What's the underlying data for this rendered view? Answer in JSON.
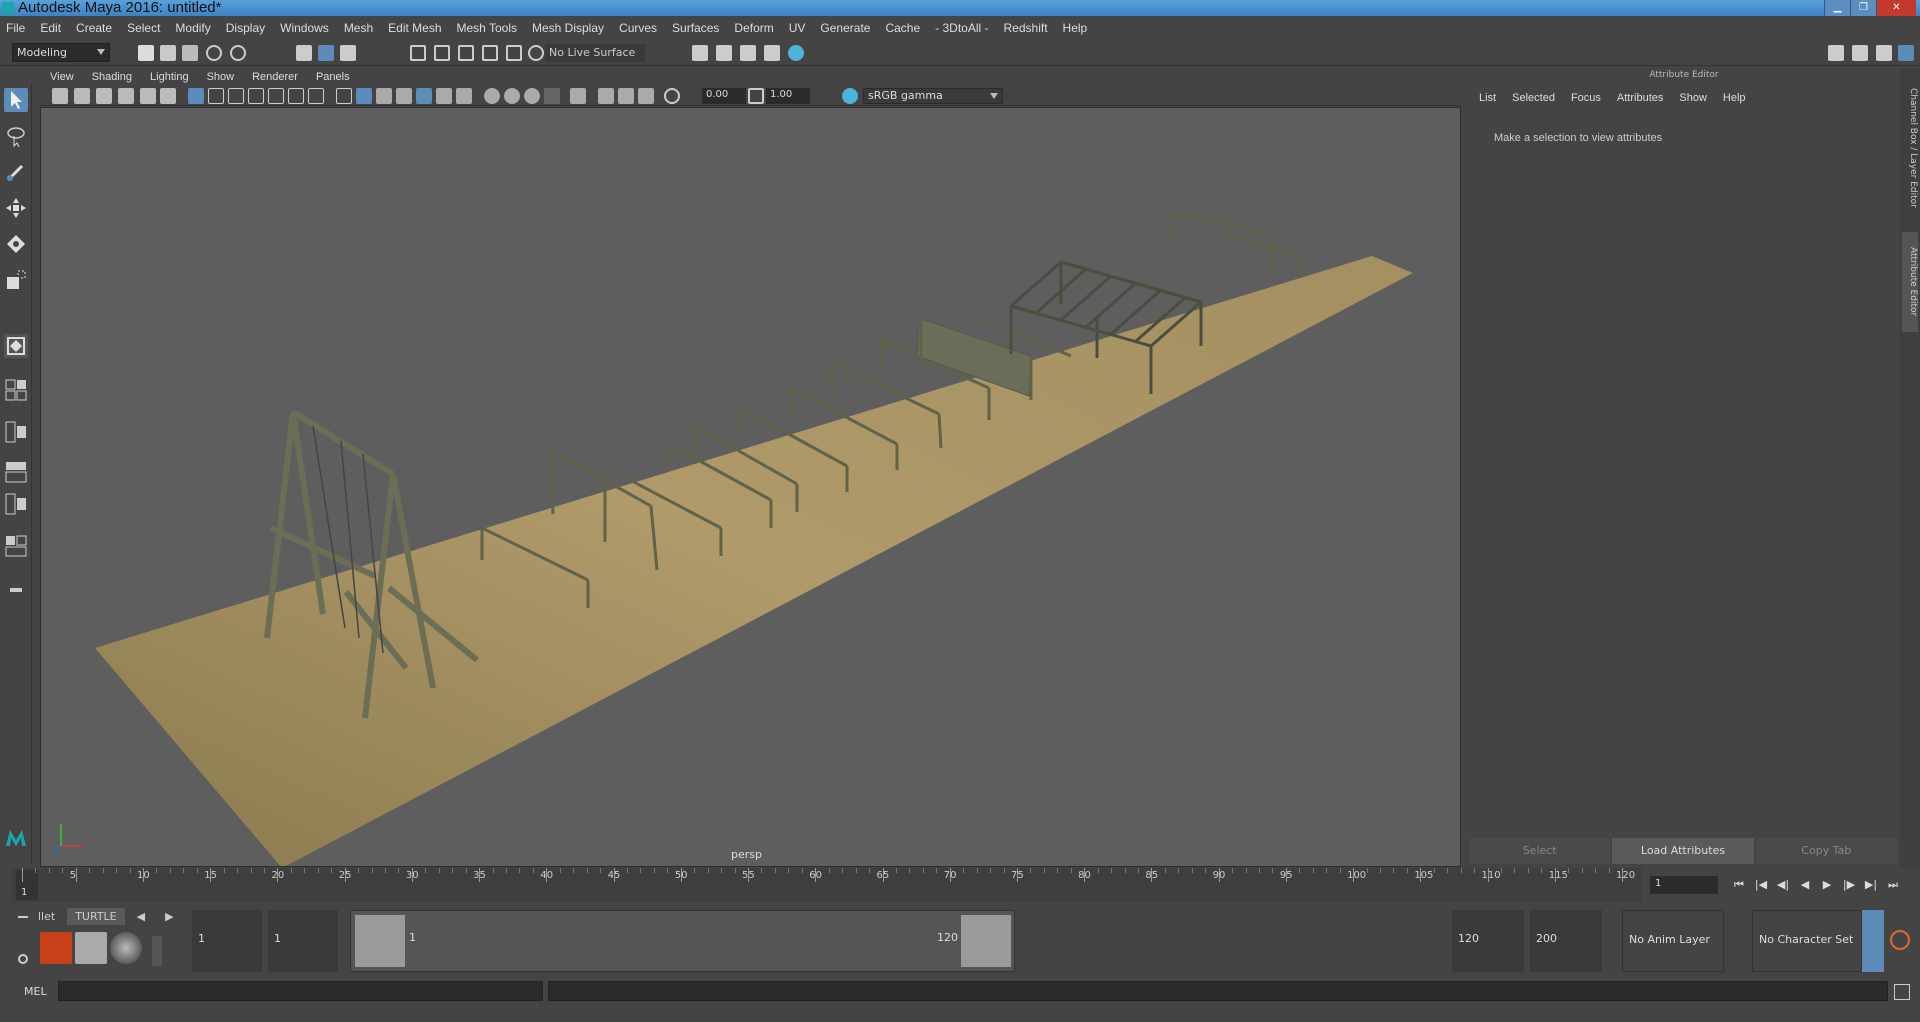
{
  "window": {
    "title": "Autodesk Maya 2016: untitled*"
  },
  "menubar": [
    "File",
    "Edit",
    "Create",
    "Select",
    "Modify",
    "Display",
    "Windows",
    "Mesh",
    "Edit Mesh",
    "Mesh Tools",
    "Mesh Display",
    "Curves",
    "Surfaces",
    "Deform",
    "UV",
    "Generate",
    "Cache",
    "- 3DtoAll -",
    "Redshift",
    "Help"
  ],
  "statusline": {
    "mode": "Modeling",
    "live_surface": "No Live Surface"
  },
  "viewport": {
    "menu": [
      "View",
      "Shading",
      "Lighting",
      "Show",
      "Renderer",
      "Panels"
    ],
    "exposure": "0.00",
    "gamma_value": "1.00",
    "color_space": "sRGB gamma",
    "camera": "persp"
  },
  "attribute_editor": {
    "title": "Attribute Editor",
    "menu": [
      "List",
      "Selected",
      "Focus",
      "Attributes",
      "Show",
      "Help"
    ],
    "message": "Make a selection to view attributes",
    "buttons": {
      "select": "Select",
      "load": "Load Attributes",
      "copy": "Copy Tab"
    },
    "side_tabs": [
      "Channel Box / Layer Editor",
      "Attribute Editor"
    ]
  },
  "timeline": {
    "ticks": [
      1,
      5,
      10,
      15,
      20,
      25,
      30,
      35,
      40,
      45,
      50,
      55,
      60,
      65,
      70,
      75,
      80,
      85,
      90,
      95,
      100,
      105,
      110,
      115,
      120
    ],
    "current_frame": "1",
    "frame_field": "1"
  },
  "shelf": {
    "tabs": [
      "llet",
      "TURTLE"
    ]
  },
  "range": {
    "start": "1",
    "playback_start": "1",
    "range_start_label": "1",
    "range_end_label": "120",
    "playback_end": "120",
    "end": "200"
  },
  "anim": {
    "layer": "No Anim Layer",
    "character_set": "No Character Set"
  },
  "cmdline": {
    "label": "MEL"
  }
}
